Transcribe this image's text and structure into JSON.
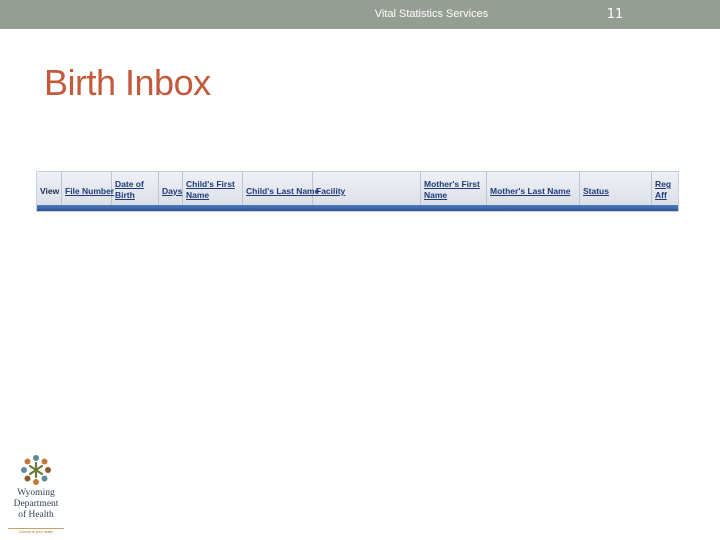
{
  "header": {
    "title": "Vital Statistics Services",
    "slide_number": "11"
  },
  "page_title": "Birth Inbox",
  "inbox_grid": {
    "columns": [
      {
        "label": "View",
        "link": false
      },
      {
        "label": "File Number",
        "link": true
      },
      {
        "label": "Date of\nBirth",
        "link": true
      },
      {
        "label": "Days",
        "link": true
      },
      {
        "label": "Child's First\nName",
        "link": true
      },
      {
        "label": "Child's Last Name",
        "link": true
      },
      {
        "label": "Facility",
        "link": true
      },
      {
        "label": "Mother's First\nName",
        "link": true
      },
      {
        "label": "Mother's Last Name",
        "link": true
      },
      {
        "label": "Status",
        "link": true
      },
      {
        "label": "Reg\nAff",
        "link": true
      }
    ]
  },
  "logo": {
    "line1": "Wyoming",
    "line2": "Department",
    "line3": "of Health",
    "tagline": "Commit to your health"
  },
  "colors": {
    "header_bar": "#959e92",
    "title": "#c45a3c",
    "grid_link": "#1f3a78",
    "grid_footer": "#2d5599"
  }
}
